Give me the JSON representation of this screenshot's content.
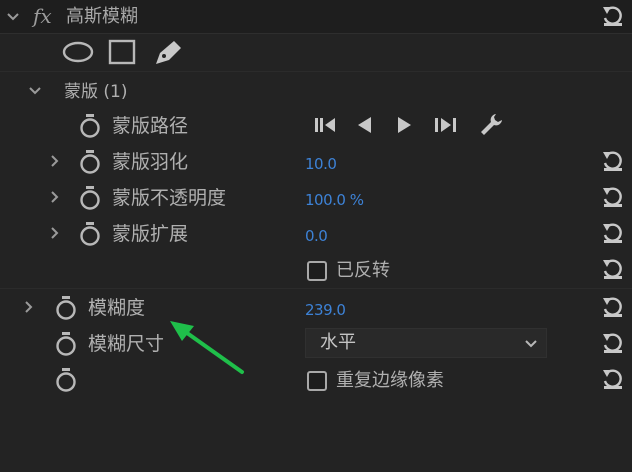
{
  "effect": {
    "fx_label": "fx",
    "name": "高斯模糊"
  },
  "mask": {
    "title": "蒙版 (1)",
    "path_label": "蒙版路径",
    "feather_label": "蒙版羽化",
    "feather_value": "10.0",
    "opacity_label": "蒙版不透明度",
    "opacity_value": "100.0 %",
    "expansion_label": "蒙版扩展",
    "expansion_value": "0.0",
    "inverted_label": "已反转"
  },
  "blurriness": {
    "label": "模糊度",
    "value": "239.0"
  },
  "blur_dimensions": {
    "label": "模糊尺寸",
    "selected": "水平"
  },
  "repeat_edge": {
    "label": "重复边缘像素"
  },
  "colors": {
    "background": "#232323",
    "header": "#1e1e1e",
    "value_blue": "#3d82d6",
    "arrow_green": "#1fbf4a"
  }
}
